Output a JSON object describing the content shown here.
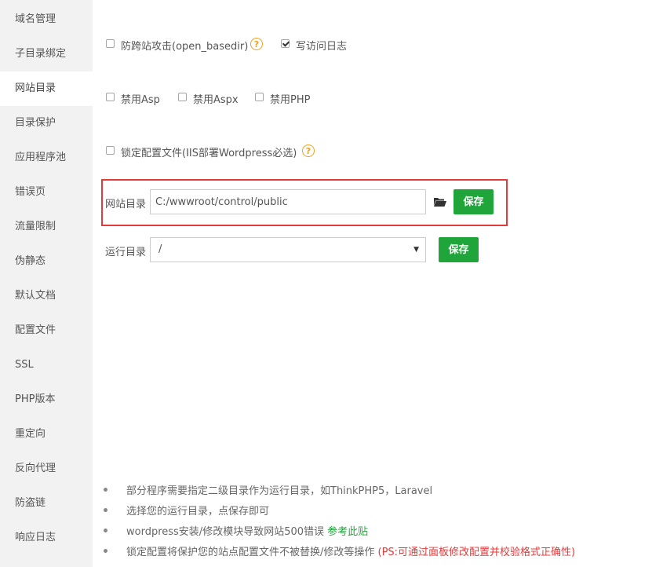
{
  "sidebar": {
    "items": [
      {
        "label": "域名管理"
      },
      {
        "label": "子目录绑定"
      },
      {
        "label": "网站目录"
      },
      {
        "label": "目录保护"
      },
      {
        "label": "应用程序池"
      },
      {
        "label": "错误页"
      },
      {
        "label": "流量限制"
      },
      {
        "label": "伪静态"
      },
      {
        "label": "默认文档"
      },
      {
        "label": "配置文件"
      },
      {
        "label": "SSL"
      },
      {
        "label": "PHP版本"
      },
      {
        "label": "重定向"
      },
      {
        "label": "反向代理"
      },
      {
        "label": "防盗链"
      },
      {
        "label": "响应日志"
      }
    ],
    "active_index": 2
  },
  "options": {
    "anti_xss": {
      "label": "防跨站攻击(open_basedir)",
      "checked": false
    },
    "access_log": {
      "label": "写访问日志",
      "checked": true
    },
    "disable_asp": {
      "label": "禁用Asp",
      "checked": false
    },
    "disable_aspx": {
      "label": "禁用Aspx",
      "checked": false
    },
    "disable_php": {
      "label": "禁用PHP",
      "checked": false
    },
    "lock_config": {
      "label": "锁定配置文件(IIS部署Wordpress必选)",
      "checked": false
    },
    "help_glyph": "?"
  },
  "site_dir": {
    "label": "网站目录",
    "value": "C:/wwwroot/control/public",
    "folder_icon": "folder-open-icon",
    "save_label": "保存"
  },
  "run_dir": {
    "label": "运行目录",
    "selected": "/",
    "arrow": "▼",
    "save_label": "保存"
  },
  "tips": {
    "t1": "部分程序需要指定二级目录作为运行目录，如ThinkPHP5，Laravel",
    "t2": "选择您的运行目录，点保存即可",
    "t3_text": "wordpress安装/修改模块导致网站500错误 ",
    "t3_link": "参考此贴",
    "t4_text": "锁定配置将保护您的站点配置文件不被替换/修改等操作 ",
    "t4_red": "(PS:可通过面板修改配置并校验格式正确性)"
  },
  "colors": {
    "accent": "#20a53a",
    "highlight_border": "#e53a3a",
    "help": "#f0a020",
    "sidebar_bg": "#f2f2f2"
  }
}
